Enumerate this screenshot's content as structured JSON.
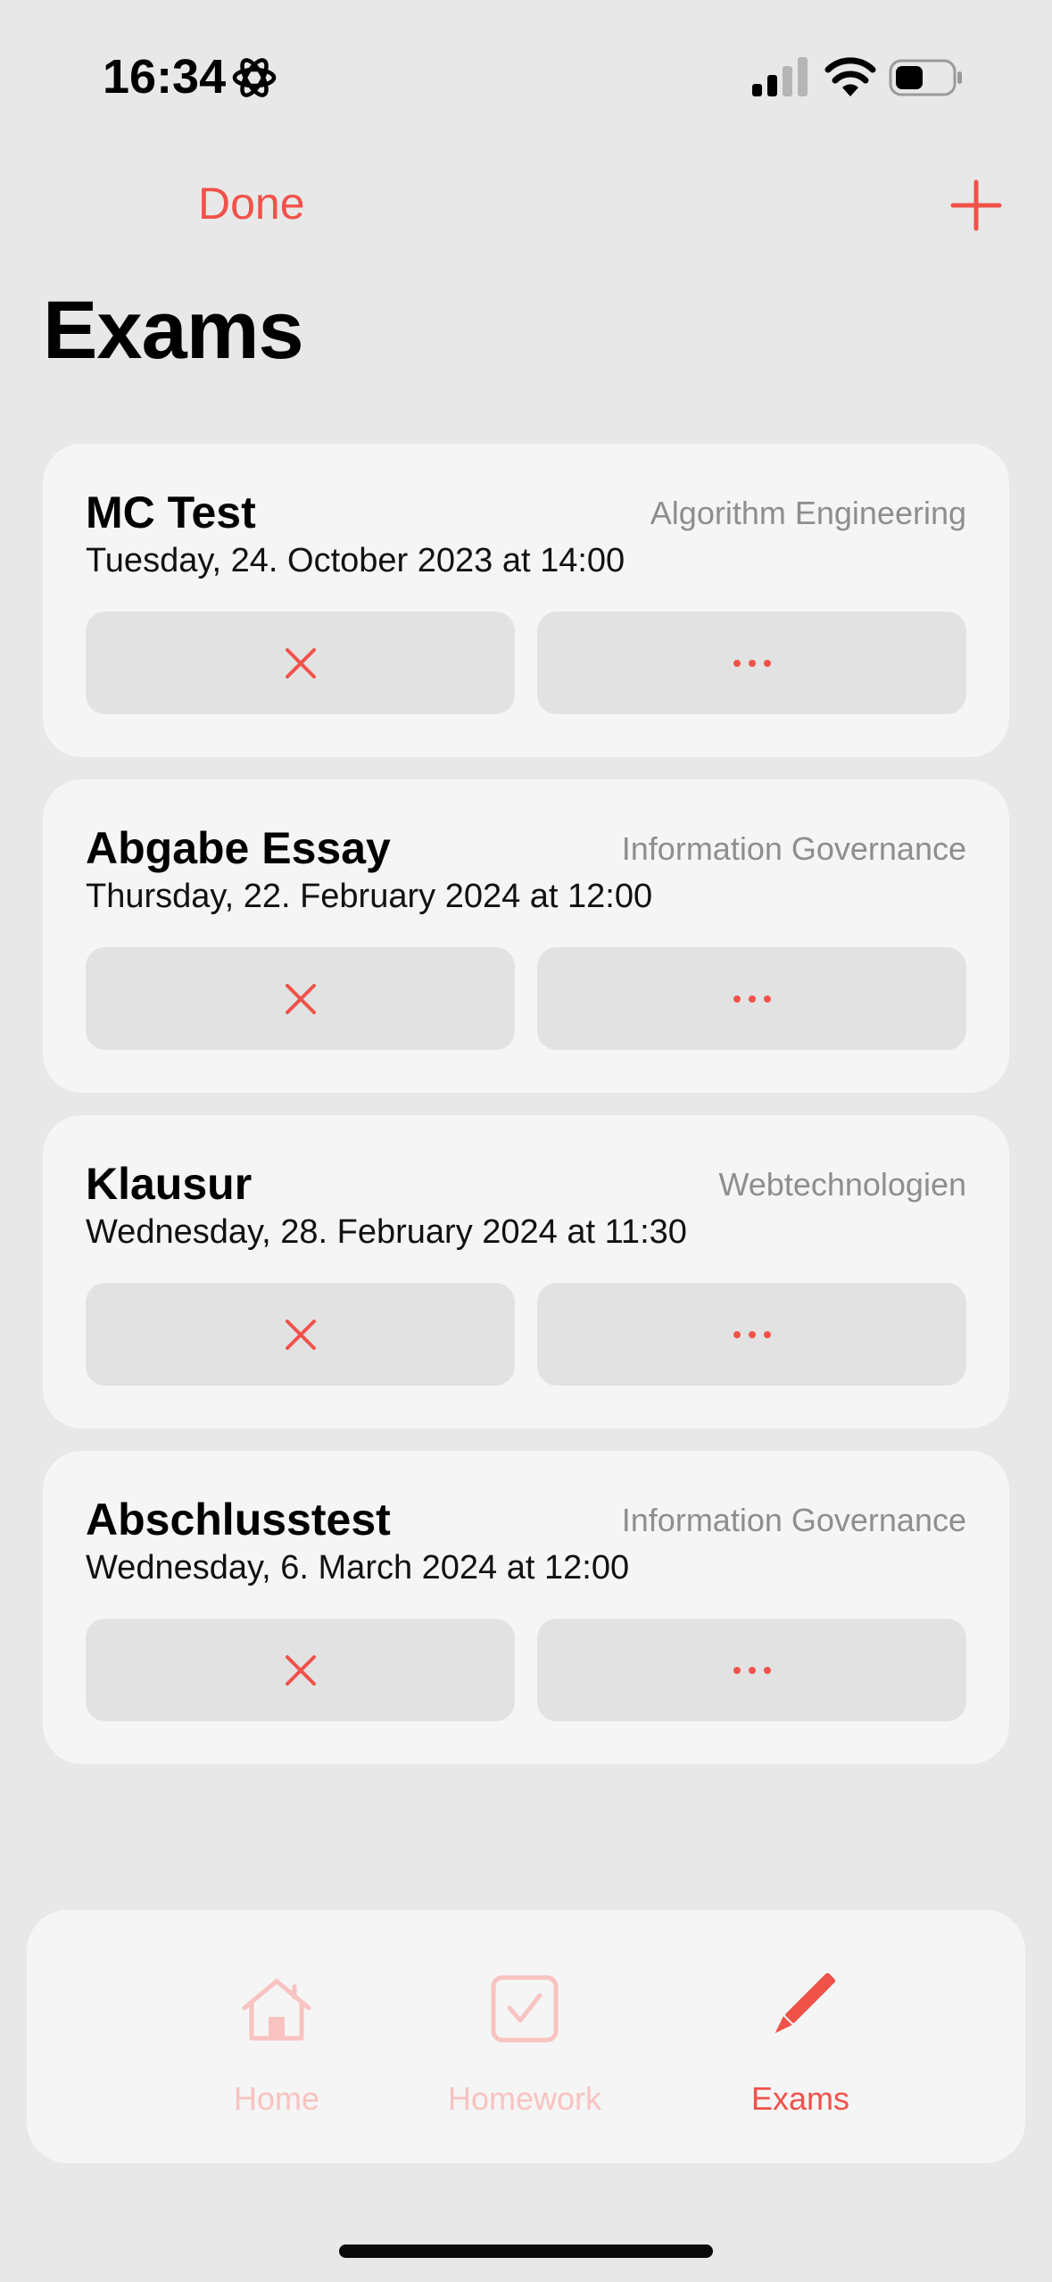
{
  "status_bar": {
    "time": "16:34"
  },
  "nav": {
    "done_label": "Done",
    "add_icon": "plus-icon"
  },
  "page": {
    "title": "Exams"
  },
  "exams": [
    {
      "title": "MC Test",
      "course": "Algorithm Engineering",
      "date": "Tuesday, 24. October 2023 at 14:00"
    },
    {
      "title": "Abgabe Essay",
      "course": "Information Governance",
      "date": "Thursday, 22. February 2024 at 12:00"
    },
    {
      "title": "Klausur",
      "course": "Webtechnologien",
      "date": "Wednesday, 28. February 2024 at 11:30"
    },
    {
      "title": "Abschlusstest",
      "course": "Information Governance",
      "date": "Wednesday, 6. March 2024 at 12:00"
    }
  ],
  "tabs": [
    {
      "label": "Home",
      "icon": "house-icon",
      "active": false
    },
    {
      "label": "Homework",
      "icon": "checkbox-icon",
      "active": false
    },
    {
      "label": "Exams",
      "icon": "pencil-icon",
      "active": true
    }
  ],
  "colors": {
    "accent": "#f0524a",
    "accent_faded": "#f8c3c0",
    "background": "#e8e8e8",
    "card": "#f5f5f5",
    "button": "#e2e2e2"
  }
}
